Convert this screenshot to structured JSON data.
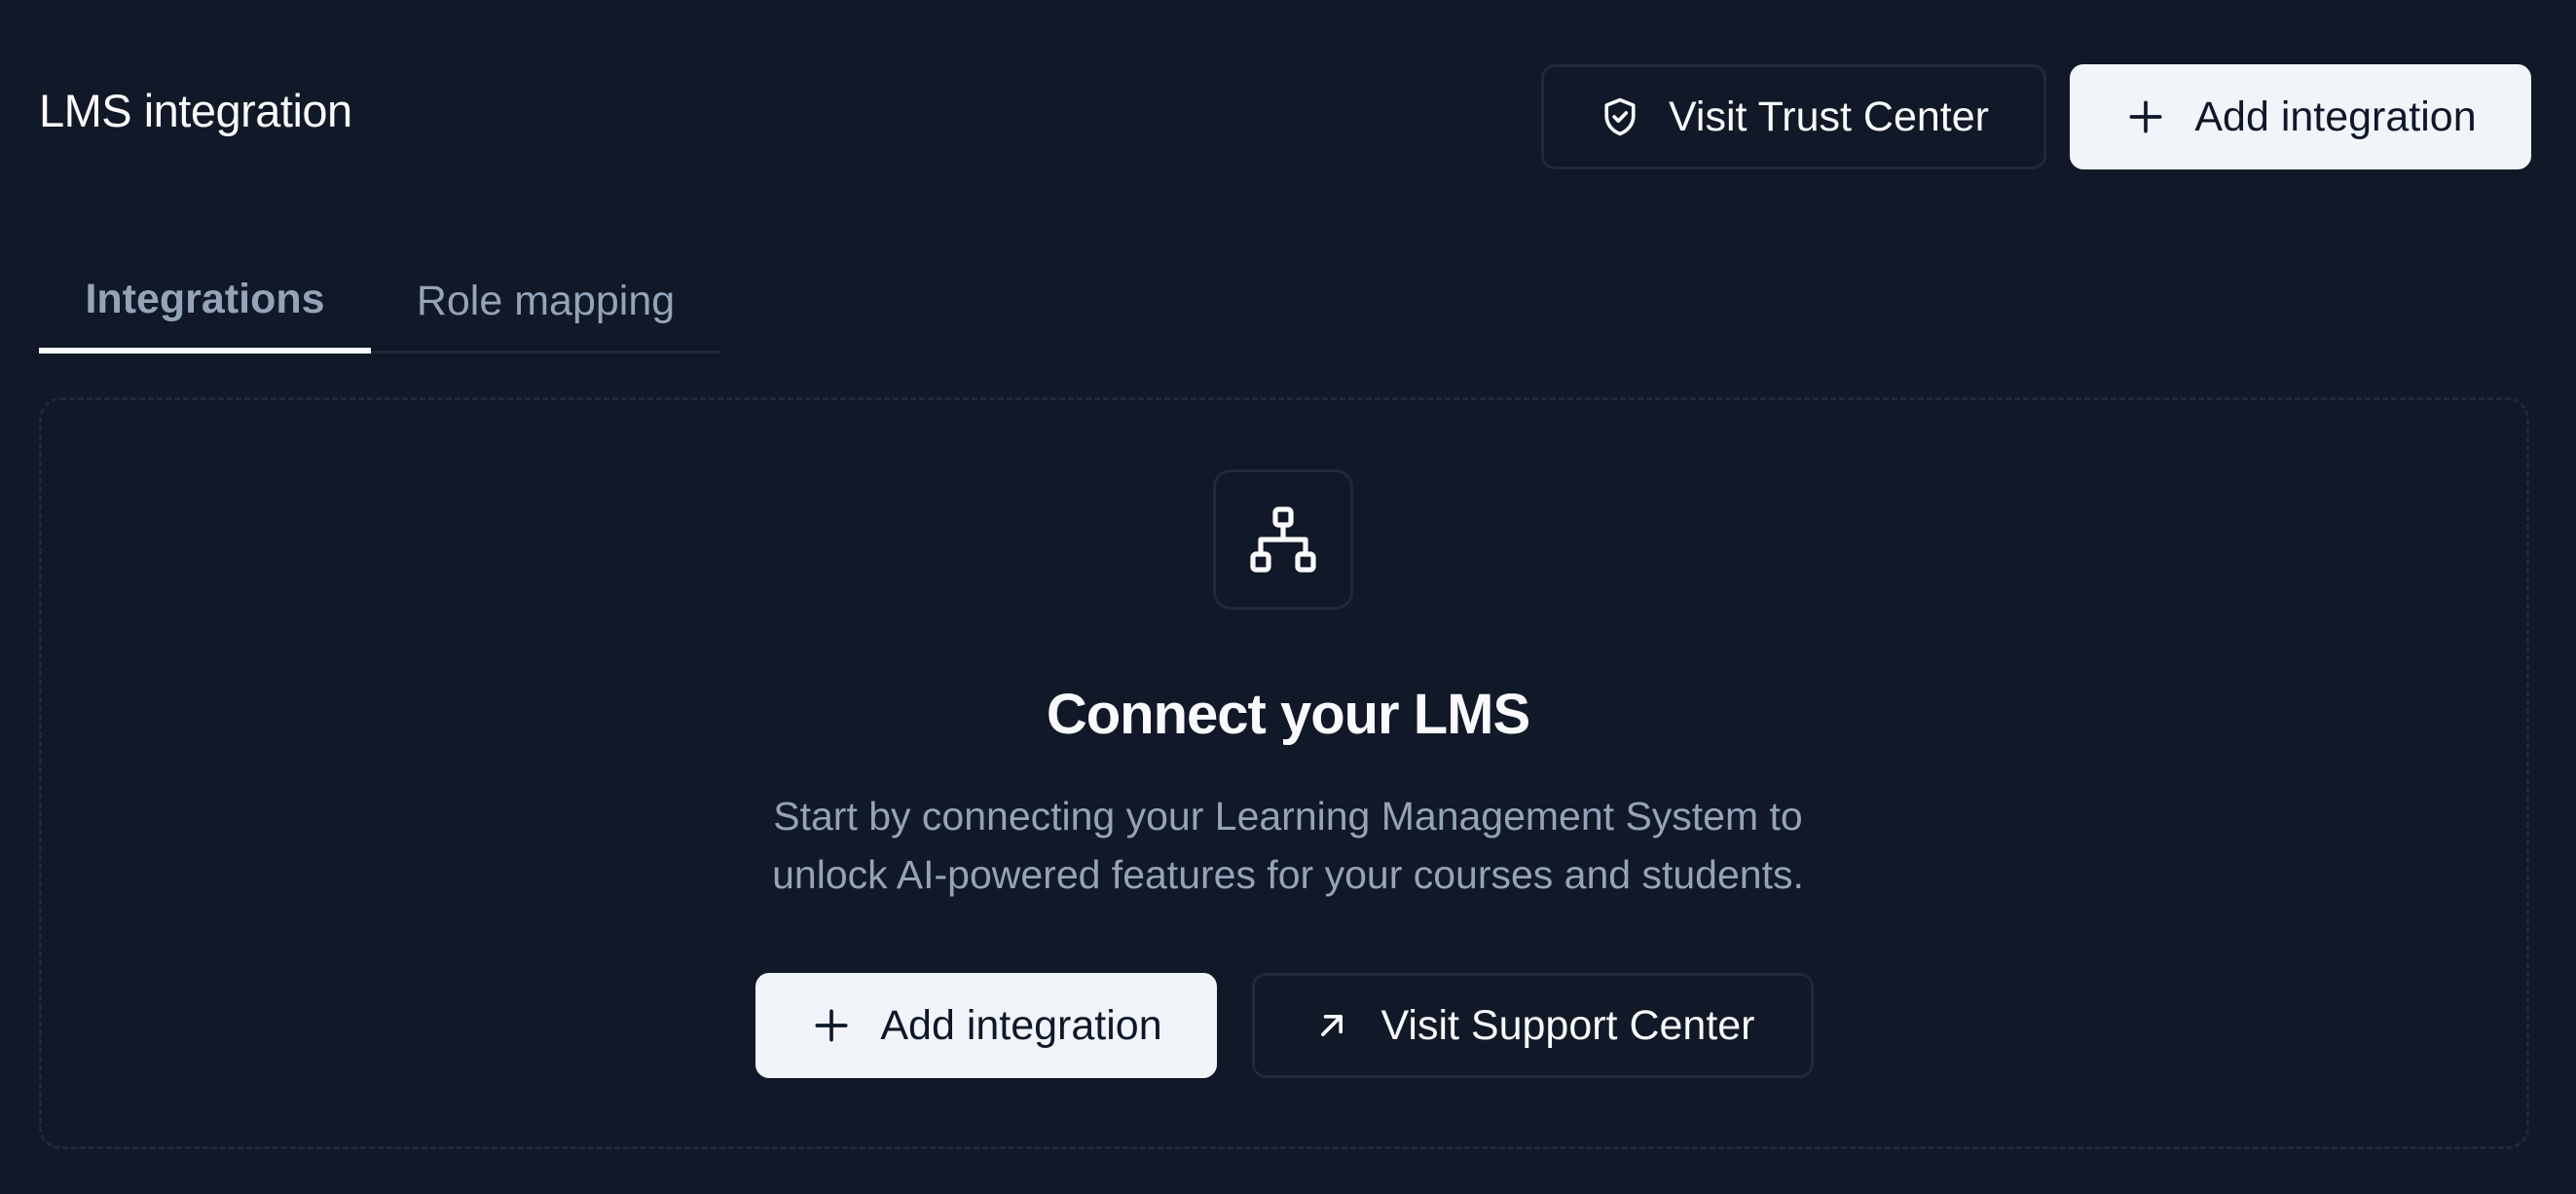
{
  "header": {
    "title": "LMS integration",
    "trust_button": {
      "label": "Visit Trust Center",
      "icon": "shield-check-icon"
    },
    "add_button": {
      "label": "Add integration",
      "icon": "plus-icon"
    }
  },
  "tabs": [
    {
      "label": "Integrations",
      "active": true
    },
    {
      "label": "Role mapping",
      "active": false
    }
  ],
  "empty_state": {
    "icon": "hierarchy-network-icon",
    "title": "Connect your LMS",
    "description_lines": [
      "Start by connecting your Learning Management System to",
      "unlock AI-powered features for your courses and students."
    ],
    "add_button": {
      "label": "Add integration",
      "icon": "plus-icon"
    },
    "support_button": {
      "label": "Visit Support Center",
      "icon": "arrow-up-right-icon"
    }
  },
  "colors": {
    "background": "#111827",
    "border": "#1f2937",
    "text_primary": "#f8fafc",
    "text_muted": "#94a3b8",
    "button_light": "#f1f5f9"
  }
}
